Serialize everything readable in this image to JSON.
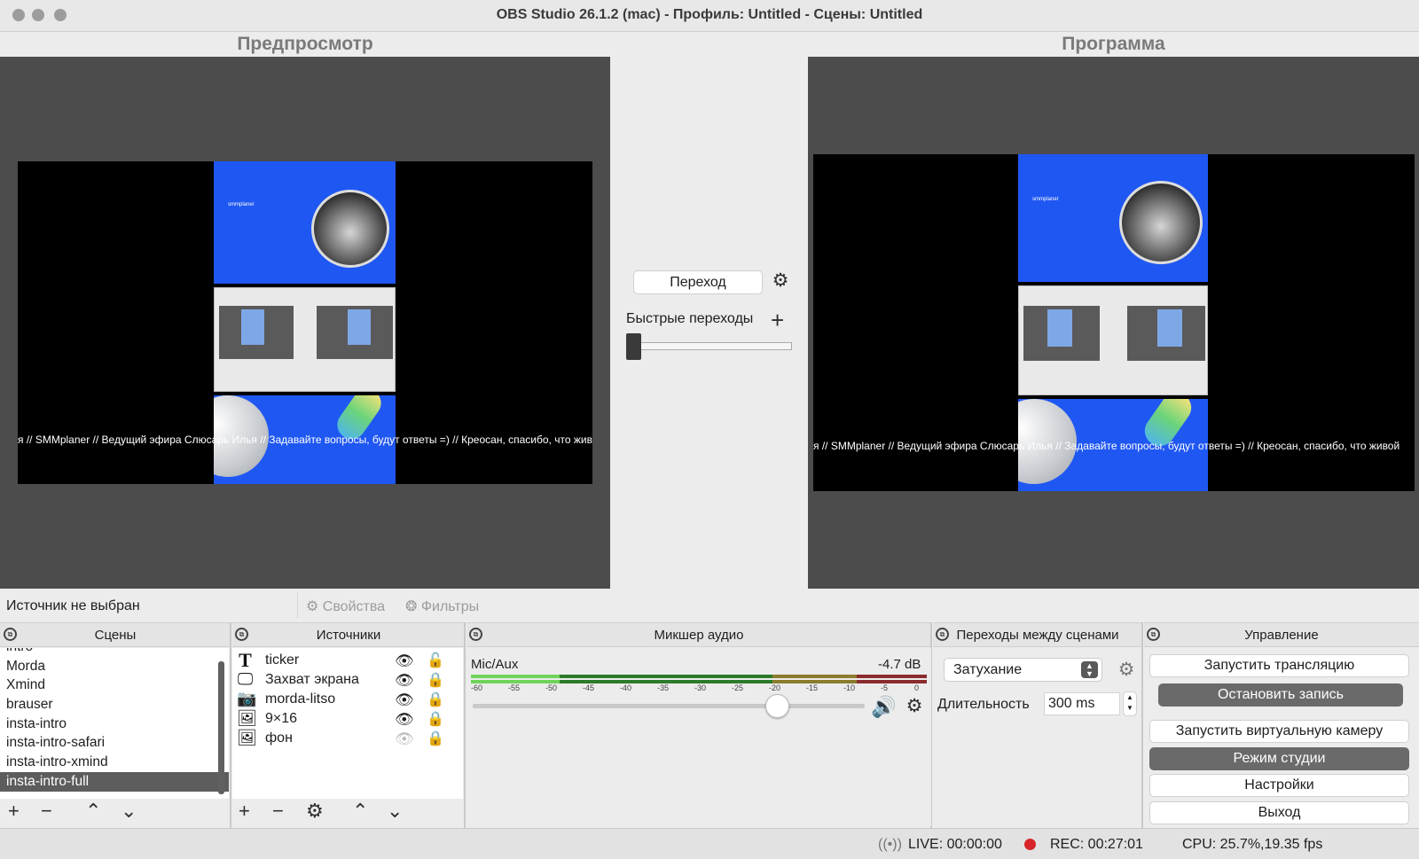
{
  "window": {
    "title": "OBS Studio 26.1.2 (mac) - Профиль: Untitled - Сцены: Untitled"
  },
  "preview": {
    "label": "Предпросмотр",
    "ticker_text": "я // SMMplaner // Ведущий эфира Слюсарь Илья // Задавайте вопросы, будут ответы =) // Креосан, спасибо, что живой"
  },
  "program": {
    "label": "Программа",
    "ticker_text": "я // SMMplaner // Ведущий эфира Слюсарь Илья // Задавайте вопросы, будут ответы =) // Креосан, спасибо, что живой"
  },
  "transition": {
    "button_label": "Переход",
    "quick_label": "Быстрые переходы"
  },
  "context_bar": {
    "source_status": "Источник не выбран",
    "properties_label": "Свойства",
    "filters_label": "Фильтры"
  },
  "docks": {
    "scenes": "Сцены",
    "sources": "Источники",
    "mixer": "Микшер аудио",
    "transitions": "Переходы между сценами",
    "controls": "Управление"
  },
  "scenes": [
    "intro",
    "Morda",
    "Xmind",
    "brauser",
    "insta-intro",
    "insta-intro-safari",
    "insta-intro-xmind",
    "insta-intro-full"
  ],
  "selected_scene": "insta-intro-full",
  "sources": [
    {
      "icon": "text-icon",
      "name": "ticker",
      "visible": true,
      "locked": false
    },
    {
      "icon": "monitor-icon",
      "name": "Захват экрана",
      "visible": true,
      "locked": true
    },
    {
      "icon": "camera-icon",
      "name": "morda-litso",
      "visible": true,
      "locked": true
    },
    {
      "icon": "image-icon",
      "name": "9×16",
      "visible": true,
      "locked": true
    },
    {
      "icon": "image-icon",
      "name": "фон",
      "visible": false,
      "locked": true
    }
  ],
  "mixer": {
    "channel_name": "Mic/Aux",
    "level_db": "-4.7 dB",
    "scale": [
      "-60",
      "-55",
      "-50",
      "-45",
      "-40",
      "-35",
      "-30",
      "-25",
      "-20",
      "-15",
      "-10",
      "-5",
      "0"
    ],
    "volume_fraction": 0.74
  },
  "scene_transitions": {
    "selected": "Затухание",
    "duration_label": "Длительность",
    "duration_value": "300 ms"
  },
  "controls": {
    "start_stream": "Запустить трансляцию",
    "stop_recording": "Остановить запись",
    "start_virtual_cam": "Запустить виртуальную камеру",
    "studio_mode": "Режим студии",
    "settings": "Настройки",
    "exit": "Выход"
  },
  "statusbar": {
    "live": "LIVE: 00:00:00",
    "rec": "REC: 00:27:01",
    "cpu": "CPU: 25.7%,19.35 fps"
  },
  "colors": {
    "rec_dot": "#d7262b",
    "meter_green": "#5dc24c",
    "meter_yellow": "#d9c34a",
    "meter_red": "#d8444b",
    "scene_blue": "#1f57f2"
  }
}
